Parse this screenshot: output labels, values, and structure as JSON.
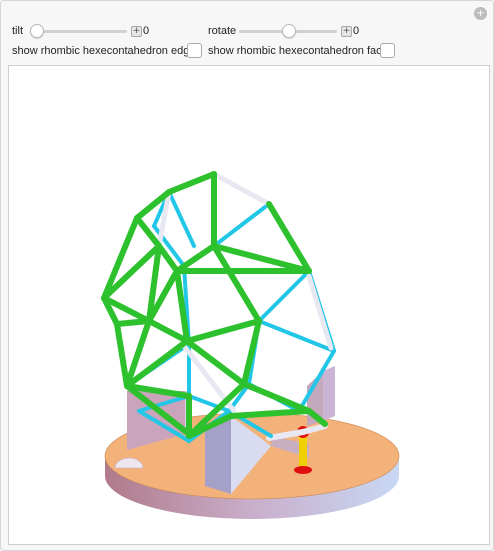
{
  "controls": {
    "tilt": {
      "label": "tilt",
      "value": "0",
      "level": 0
    },
    "rotate": {
      "label": "rotate",
      "value": "0",
      "level": 0.5
    },
    "edges_checkbox": {
      "label": "show rhombic hexecontahedron edges",
      "checked": false
    },
    "faces_checkbox": {
      "label": "show rhombic hexecontahedron faces",
      "checked": false
    }
  },
  "icons": {
    "options": "gear-icon",
    "step": "plus-icon"
  },
  "colors": {
    "strut_green": "#2ec12e",
    "strut_cyan": "#22c6e6",
    "strut_white": "#e8e8f2",
    "base_top": "#f2b27a",
    "base_side": "#c9a3bb",
    "stand_red": "#e01010",
    "stand_yellow": "#f0d000"
  }
}
